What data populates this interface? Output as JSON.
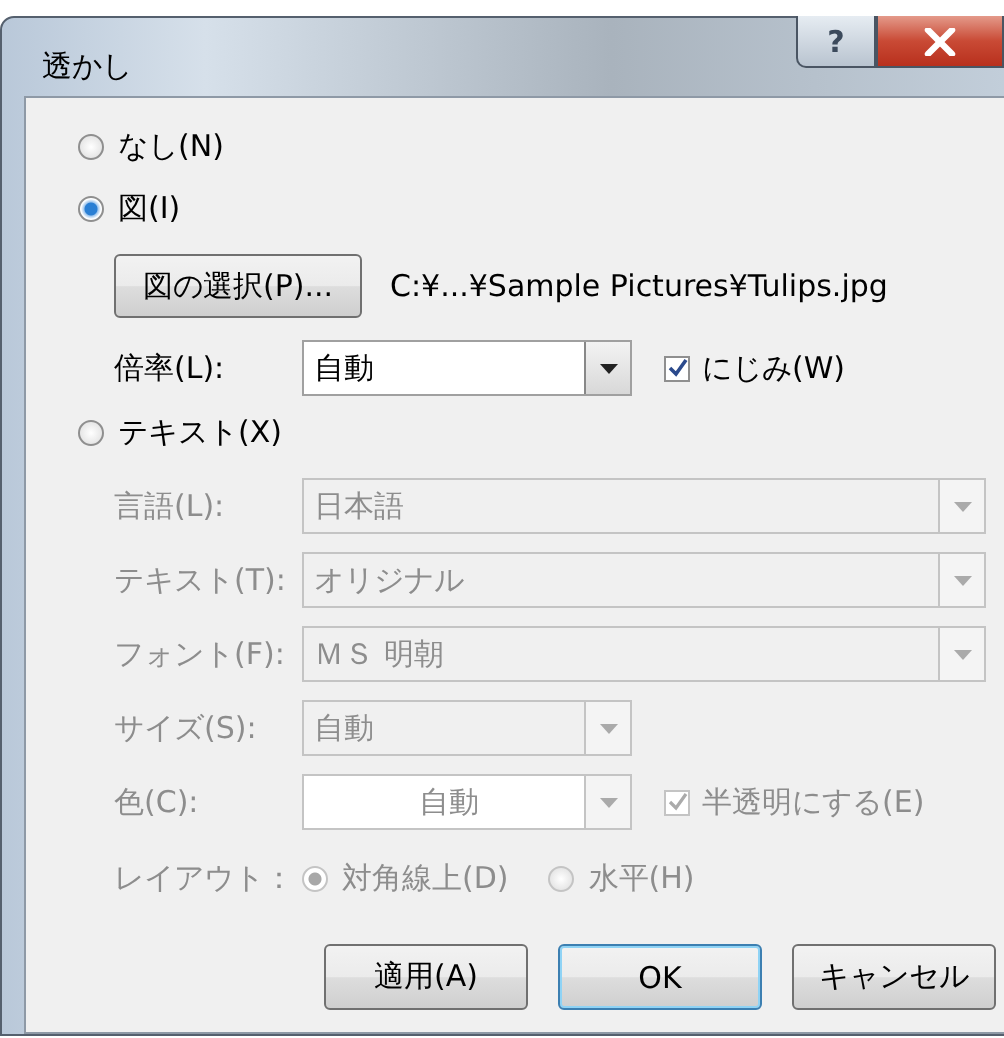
{
  "window": {
    "title": "透かし",
    "help_button": "?"
  },
  "none_option": {
    "label": "なし(N)",
    "selected": false
  },
  "picture_option": {
    "label": "図(I)",
    "selected": true,
    "select_button": "図の選択(P)...",
    "path": "C:¥...¥Sample Pictures¥Tulips.jpg",
    "scale": {
      "label": "倍率(L):",
      "value": "自動",
      "disabled": false
    },
    "washout": {
      "label": "にじみ(W)",
      "checked": true,
      "disabled": false
    }
  },
  "text_option": {
    "label": "テキスト(X)",
    "selected": false,
    "fields": [
      {
        "kind": "wide_combo",
        "label": "言語(L):",
        "value": "日本語",
        "disabled": true
      },
      {
        "kind": "wide_combo",
        "label": "テキスト(T):",
        "value": "オリジナル",
        "disabled": true
      },
      {
        "kind": "wide_combo",
        "label": "フォント(F):",
        "value": "ＭＳ 明朝",
        "disabled": true
      },
      {
        "kind": "narrow_combo",
        "label": "サイズ(S):",
        "value": "自動",
        "disabled": true
      },
      {
        "kind": "color",
        "label": "色(C):",
        "value": "自動",
        "disabled": true,
        "checkbox": {
          "label": "半透明にする(E)",
          "checked": true
        }
      },
      {
        "kind": "layout",
        "label": "レイアウト：",
        "disabled": true,
        "choices": [
          {
            "label": "対角線上(D)",
            "selected": true
          },
          {
            "label": "水平(H)",
            "selected": false
          }
        ]
      }
    ]
  },
  "buttons": [
    {
      "label": "適用(A)",
      "default": false
    },
    {
      "label": "OK",
      "default": true
    },
    {
      "label": "キャンセル",
      "default": false
    }
  ]
}
